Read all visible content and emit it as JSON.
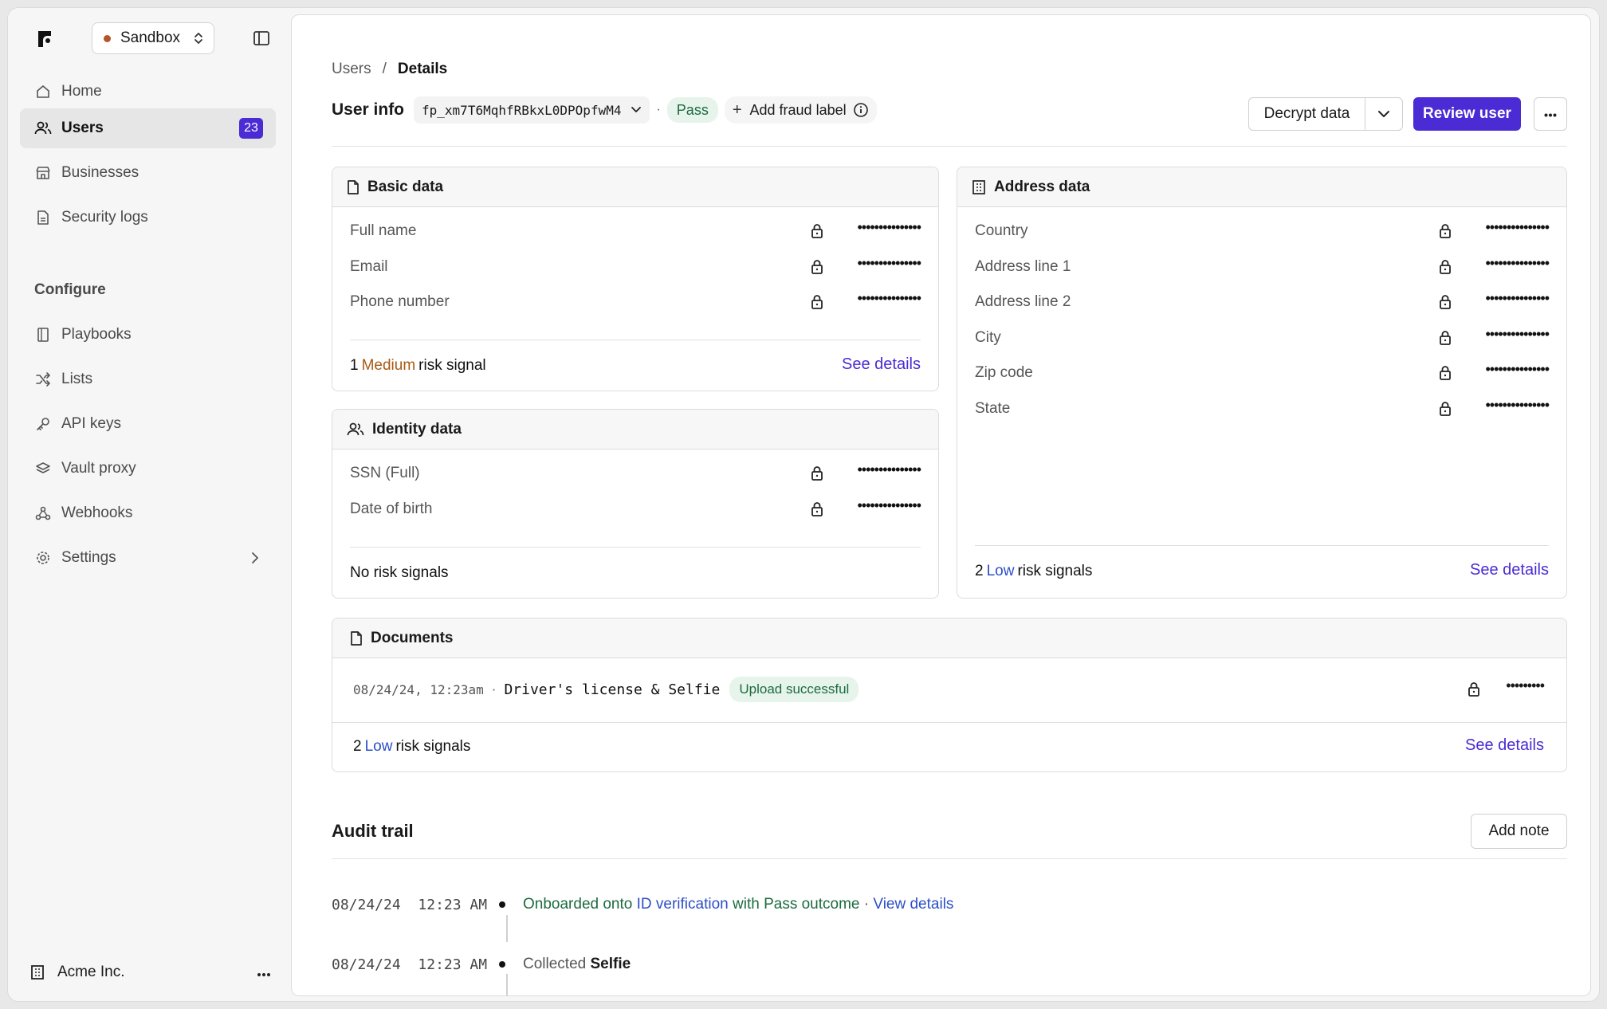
{
  "sidebar": {
    "env_label": "Sandbox",
    "nav": [
      {
        "label": "Home",
        "icon": "home-icon"
      },
      {
        "label": "Users",
        "icon": "users-icon",
        "badge": "23",
        "active": true
      },
      {
        "label": "Businesses",
        "icon": "store-icon"
      },
      {
        "label": "Security logs",
        "icon": "file-icon"
      }
    ],
    "configure_label": "Configure",
    "config_nav": [
      {
        "label": "Playbooks",
        "icon": "book-icon"
      },
      {
        "label": "Lists",
        "icon": "shuffle-icon"
      },
      {
        "label": "API keys",
        "icon": "key-icon"
      },
      {
        "label": "Vault proxy",
        "icon": "layers-icon"
      },
      {
        "label": "Webhooks",
        "icon": "webhook-icon"
      },
      {
        "label": "Settings",
        "icon": "gear-icon"
      }
    ],
    "org_name": "Acme Inc."
  },
  "breadcrumb": {
    "parent": "Users",
    "sep": "/",
    "current": "Details"
  },
  "header": {
    "title": "User info",
    "fp_id": "fp_xm7T6MqhfRBkxL0DPOpfwM4",
    "dot": "·",
    "status": "Pass",
    "add_fraud_label": "Add fraud label",
    "decrypt_label": "Decrypt data",
    "review_label": "Review user"
  },
  "basic_data": {
    "title": "Basic data",
    "fields": [
      {
        "label": "Full name",
        "value": "•••••••••••••••"
      },
      {
        "label": "Email",
        "value": "•••••••••••••••"
      },
      {
        "label": "Phone number",
        "value": "•••••••••••••••"
      }
    ],
    "risk_count": "1",
    "risk_level": "Medium",
    "risk_suffix": "risk signal",
    "see_details": "See details"
  },
  "identity_data": {
    "title": "Identity data",
    "fields": [
      {
        "label": "SSN (Full)",
        "value": "•••••••••••••••"
      },
      {
        "label": "Date of birth",
        "value": "•••••••••••••••"
      }
    ],
    "risk_text": "No risk signals"
  },
  "address_data": {
    "title": "Address data",
    "fields": [
      {
        "label": "Country",
        "value": "•••••••••••••••"
      },
      {
        "label": "Address line 1",
        "value": "•••••••••••••••"
      },
      {
        "label": "Address line 2",
        "value": "•••••••••••••••"
      },
      {
        "label": "City",
        "value": "•••••••••••••••"
      },
      {
        "label": "Zip code",
        "value": "•••••••••••••••"
      },
      {
        "label": "State",
        "value": "•••••••••••••••"
      }
    ],
    "risk_count": "2",
    "risk_level": "Low",
    "risk_suffix": "risk signals",
    "see_details": "See details"
  },
  "documents": {
    "title": "Documents",
    "timestamp": "08/24/24, 12:23am",
    "sep": "·",
    "doc_name": "Driver's license & Selfie",
    "status": "Upload successful",
    "value": "•••••••••",
    "risk_count": "2",
    "risk_level": "Low",
    "risk_suffix": "risk signals",
    "see_details": "See details"
  },
  "audit": {
    "title": "Audit trail",
    "add_note": "Add note",
    "events": [
      {
        "date": "08/24/24",
        "time": "12:23 AM",
        "prefix": "Onboarded onto",
        "highlight": "ID verification",
        "suffix": "with Pass outcome",
        "sep": "·",
        "link": "View details"
      },
      {
        "date": "08/24/24",
        "time": "12:23 AM",
        "prefix": "Collected",
        "highlight": "Selfie"
      }
    ]
  },
  "colors": {
    "accent": "#4a2bd4",
    "pass_green": "#1b6b3e",
    "medium": "#a85a14",
    "low": "#2c4fc7"
  }
}
